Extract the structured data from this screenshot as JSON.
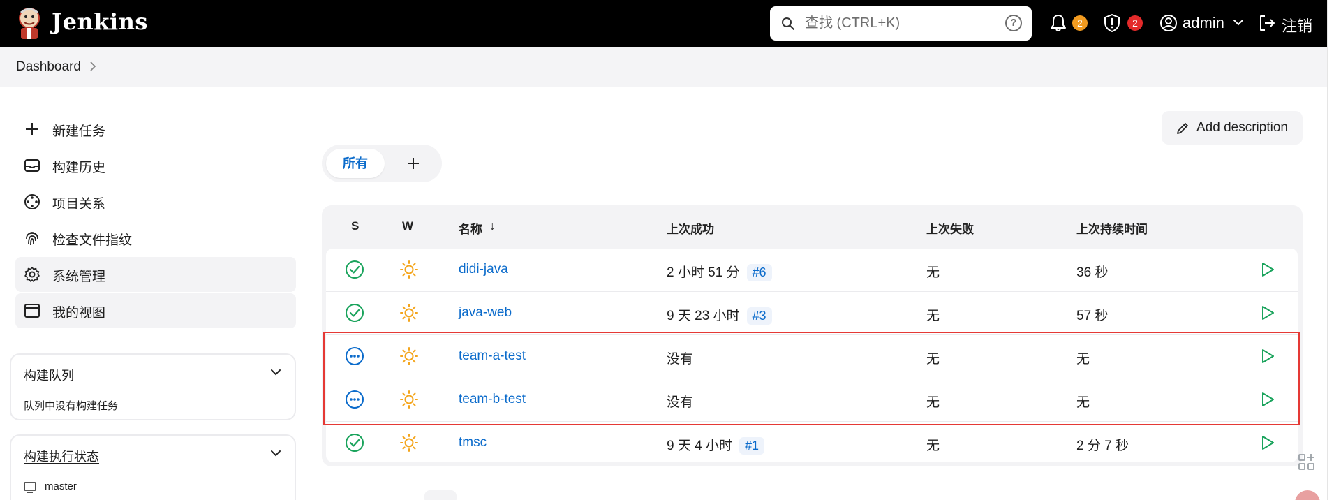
{
  "app": {
    "brand": "Jenkins",
    "search_placeholder": "查找 (CTRL+K)",
    "help_glyph": "?",
    "notifications_count": "2",
    "security_count": "2",
    "user_name": "admin",
    "logout_label": "注销"
  },
  "breadcrumb": {
    "root": "Dashboard"
  },
  "sidebar": {
    "items": [
      {
        "label": "新建任务",
        "icon": "plus-icon"
      },
      {
        "label": "构建历史",
        "icon": "inbox-icon"
      },
      {
        "label": "项目关系",
        "icon": "relations-icon"
      },
      {
        "label": "检查文件指纹",
        "icon": "fingerprint-icon"
      },
      {
        "label": "系统管理",
        "icon": "gear-icon"
      },
      {
        "label": "我的视图",
        "icon": "window-icon"
      }
    ],
    "queue": {
      "title": "构建队列",
      "empty_text": "队列中没有构建任务"
    },
    "executors": {
      "title": "构建执行状态",
      "node": "master"
    }
  },
  "main": {
    "add_description": "Add description",
    "tabs": {
      "all": "所有",
      "add": "+"
    },
    "columns": {
      "s": "S",
      "w": "W",
      "name": "名称",
      "name_sort": "↓",
      "last_success": "上次成功",
      "last_failure": "上次失败",
      "last_duration": "上次持续时间"
    },
    "jobs": [
      {
        "status": "success",
        "weather": "sunny",
        "name": "didi-java",
        "last_success": "2 小时 51 分",
        "build": "#6",
        "last_failure": "无",
        "duration": "36 秒"
      },
      {
        "status": "success",
        "weather": "sunny",
        "name": "java-web",
        "last_success": "9 天 23 小时",
        "build": "#3",
        "last_failure": "无",
        "duration": "57 秒"
      },
      {
        "status": "notbuilt",
        "weather": "sunny",
        "name": "team-a-test",
        "last_success": "没有",
        "build": "",
        "last_failure": "无",
        "duration": "无"
      },
      {
        "status": "notbuilt",
        "weather": "sunny",
        "name": "team-b-test",
        "last_success": "没有",
        "build": "",
        "last_failure": "无",
        "duration": "无"
      },
      {
        "status": "success",
        "weather": "sunny",
        "name": "tmsc",
        "last_success": "9 天 4 小时",
        "build": "#1",
        "last_failure": "无",
        "duration": "2 分 7 秒"
      }
    ]
  },
  "colors": {
    "header_bg": "#000000",
    "link": "#0b6bcb",
    "success": "#1aa35c",
    "weather": "#f4a51c",
    "badge_orange": "#f29b20",
    "badge_red": "#e32a2a",
    "highlight": "#e53935"
  }
}
